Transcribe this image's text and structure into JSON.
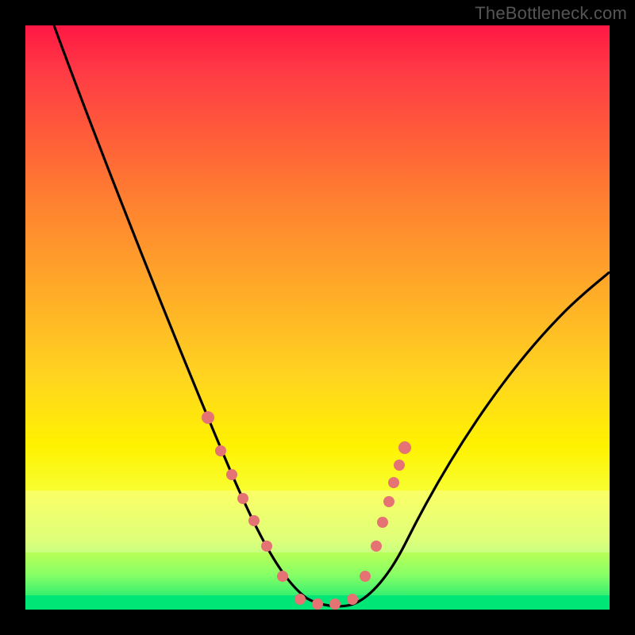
{
  "watermark": "TheBottleneck.com",
  "chart_data": {
    "type": "line",
    "title": "",
    "xlabel": "",
    "ylabel": "",
    "xlim": [
      0,
      100
    ],
    "ylim": [
      0,
      100
    ],
    "series": [
      {
        "name": "bottleneck-curve",
        "x": [
          5,
          10,
          15,
          20,
          25,
          30,
          33,
          36,
          39,
          42,
          45,
          48,
          50,
          52,
          54,
          56,
          58,
          60,
          64,
          68,
          72,
          76,
          80,
          85,
          90,
          96,
          100
        ],
        "y": [
          100,
          88,
          76,
          64,
          52,
          40,
          32,
          25,
          18,
          12,
          7,
          3,
          1,
          0,
          0,
          1,
          3,
          6,
          12,
          18,
          24,
          30,
          36,
          42,
          48,
          54,
          58
        ]
      }
    ],
    "markers": [
      {
        "name": "left-arm-1",
        "x": 31,
        "y": 32
      },
      {
        "name": "left-arm-2",
        "x": 33,
        "y": 26
      },
      {
        "name": "left-arm-3",
        "x": 35,
        "y": 22
      },
      {
        "name": "left-arm-4",
        "x": 37,
        "y": 18
      },
      {
        "name": "left-arm-5",
        "x": 39,
        "y": 14
      },
      {
        "name": "left-arm-6",
        "x": 41,
        "y": 10
      },
      {
        "name": "left-arm-7",
        "x": 44,
        "y": 5
      },
      {
        "name": "trough-1",
        "x": 47,
        "y": 1.2
      },
      {
        "name": "trough-2",
        "x": 50,
        "y": 0.6
      },
      {
        "name": "trough-3",
        "x": 53,
        "y": 0.6
      },
      {
        "name": "trough-4",
        "x": 56,
        "y": 1.2
      },
      {
        "name": "right-arm-1",
        "x": 58,
        "y": 5
      },
      {
        "name": "right-arm-2",
        "x": 60,
        "y": 10
      },
      {
        "name": "right-arm-3",
        "x": 61,
        "y": 14
      },
      {
        "name": "right-arm-4",
        "x": 62,
        "y": 18
      },
      {
        "name": "right-arm-5",
        "x": 63,
        "y": 21
      },
      {
        "name": "right-arm-6",
        "x": 64,
        "y": 24
      },
      {
        "name": "right-arm-7",
        "x": 65,
        "y": 27
      }
    ],
    "grid": false,
    "legend": false
  }
}
